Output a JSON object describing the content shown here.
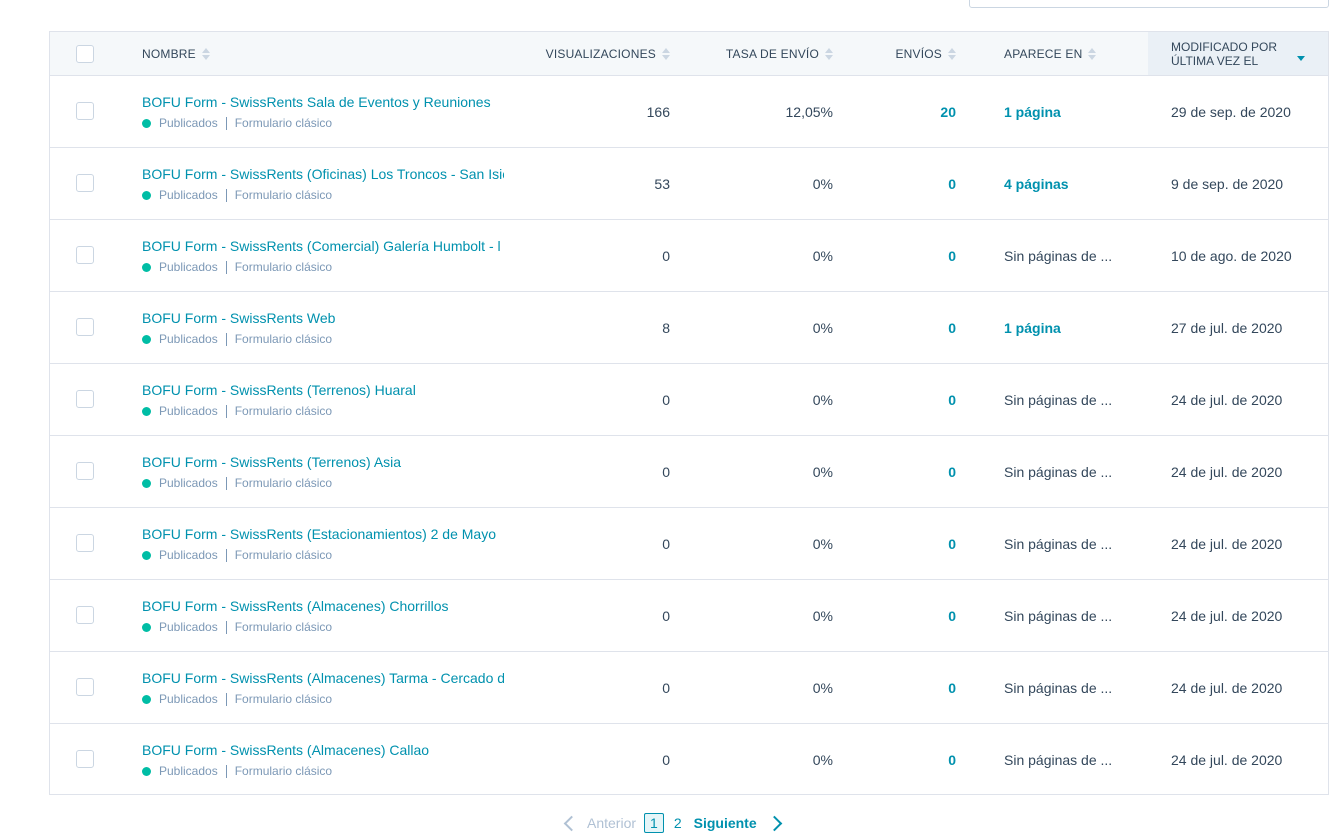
{
  "columns": {
    "name": "NOMBRE",
    "views": "VISUALIZACIONES",
    "rate": "TASA DE ENVÍO",
    "submissions": "ENVÍOS",
    "appears": "APARECE EN",
    "modified_l1": "MODIFICADO POR",
    "modified_l2": "ÚLTIMA VEZ EL"
  },
  "rows": [
    {
      "name": "BOFU Form - SwissRents Sala de Eventos y Reuniones",
      "status": "Publicados",
      "type": "Formulario clásico",
      "views": "166",
      "rate": "12,05%",
      "submissions": "20",
      "appears": "1 página",
      "appears_link": true,
      "modified": "29 de sep. de 2020"
    },
    {
      "name": "BOFU Form - SwissRents (Oficinas) Los Troncos - San Isic",
      "status": "Publicados",
      "type": "Formulario clásico",
      "views": "53",
      "rate": "0%",
      "submissions": "0",
      "appears": "4 páginas",
      "appears_link": true,
      "modified": "9 de sep. de 2020"
    },
    {
      "name": "BOFU Form - SwissRents (Comercial) Galería Humbolt - l",
      "status": "Publicados",
      "type": "Formulario clásico",
      "views": "0",
      "rate": "0%",
      "submissions": "0",
      "appears": "Sin páginas de ...",
      "appears_link": false,
      "modified": "10 de ago. de 2020"
    },
    {
      "name": "BOFU Form - SwissRents Web",
      "status": "Publicados",
      "type": "Formulario clásico",
      "views": "8",
      "rate": "0%",
      "submissions": "0",
      "appears": "1 página",
      "appears_link": true,
      "modified": "27 de jul. de 2020"
    },
    {
      "name": "BOFU Form - SwissRents (Terrenos) Huaral",
      "status": "Publicados",
      "type": "Formulario clásico",
      "views": "0",
      "rate": "0%",
      "submissions": "0",
      "appears": "Sin páginas de ...",
      "appears_link": false,
      "modified": "24 de jul. de 2020"
    },
    {
      "name": "BOFU Form - SwissRents (Terrenos) Asia",
      "status": "Publicados",
      "type": "Formulario clásico",
      "views": "0",
      "rate": "0%",
      "submissions": "0",
      "appears": "Sin páginas de ...",
      "appears_link": false,
      "modified": "24 de jul. de 2020"
    },
    {
      "name": "BOFU Form - SwissRents (Estacionamientos) 2 de Mayo",
      "status": "Publicados",
      "type": "Formulario clásico",
      "views": "0",
      "rate": "0%",
      "submissions": "0",
      "appears": "Sin páginas de ...",
      "appears_link": false,
      "modified": "24 de jul. de 2020"
    },
    {
      "name": "BOFU Form - SwissRents (Almacenes) Chorrillos",
      "status": "Publicados",
      "type": "Formulario clásico",
      "views": "0",
      "rate": "0%",
      "submissions": "0",
      "appears": "Sin páginas de ...",
      "appears_link": false,
      "modified": "24 de jul. de 2020"
    },
    {
      "name": "BOFU Form - SwissRents (Almacenes) Tarma - Cercado d",
      "status": "Publicados",
      "type": "Formulario clásico",
      "views": "0",
      "rate": "0%",
      "submissions": "0",
      "appears": "Sin páginas de ...",
      "appears_link": false,
      "modified": "24 de jul. de 2020"
    },
    {
      "name": "BOFU Form - SwissRents (Almacenes) Callao",
      "status": "Publicados",
      "type": "Formulario clásico",
      "views": "0",
      "rate": "0%",
      "submissions": "0",
      "appears": "Sin páginas de ...",
      "appears_link": false,
      "modified": "24 de jul. de 2020"
    }
  ],
  "pagination": {
    "prev_label": "Anterior",
    "current_page": "1",
    "other_page": "2",
    "next_label": "Siguiente"
  },
  "colors": {
    "link": "#0091ae",
    "status_published": "#00bda5",
    "header_bg": "#f5f8fa",
    "sorted_header_bg": "#eaf0f6",
    "border": "#dfe3eb"
  }
}
